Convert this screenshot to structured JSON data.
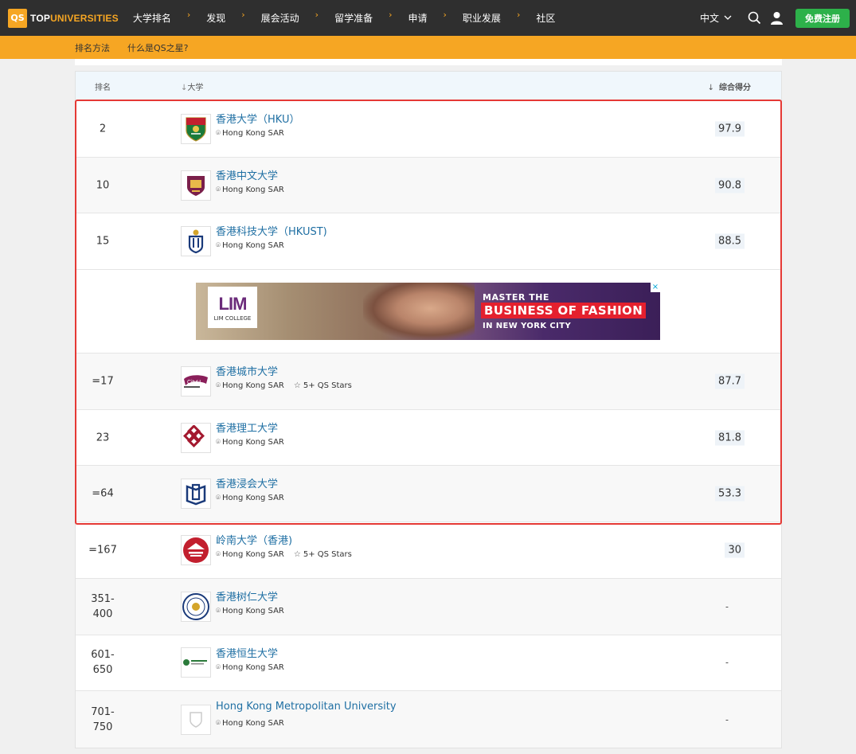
{
  "brand": {
    "logo_box": "QS",
    "logo_prefix": "TOP",
    "logo_accent": "UNIVERSITIES"
  },
  "nav": {
    "items": [
      {
        "label": "大学排名"
      },
      {
        "label": "发现"
      },
      {
        "label": "展会活动"
      },
      {
        "label": "留学准备"
      },
      {
        "label": "申请"
      },
      {
        "label": "职业发展"
      },
      {
        "label": "社区"
      }
    ],
    "language": "中文",
    "signup_label": "免费注册"
  },
  "subnav": {
    "items": [
      "排名方法",
      "什么是QS之星?"
    ]
  },
  "table": {
    "headers": {
      "rank": "排名",
      "university": "大学",
      "score": "综合得分"
    },
    "rows": [
      {
        "rank": "2",
        "name": "香港大学（HKU）",
        "location": "Hong Kong SAR",
        "stars": "",
        "score": "97.9",
        "logo": "hku-crest-icon"
      },
      {
        "rank": "10",
        "name": "香港中文大学",
        "location": "Hong Kong SAR",
        "stars": "",
        "score": "90.8",
        "logo": "cuhk-crest-icon"
      },
      {
        "rank": "15",
        "name": "香港科技大学（HKUST)",
        "location": "Hong Kong SAR",
        "stars": "",
        "score": "88.5",
        "logo": "hkust-crest-icon"
      },
      {
        "rank": "=17",
        "name": "香港城市大学",
        "location": "Hong Kong SAR",
        "stars": "5+ QS Stars",
        "score": "87.7",
        "logo": "cityu-logo-icon"
      },
      {
        "rank": "23",
        "name": "香港理工大学",
        "location": "Hong Kong SAR",
        "stars": "",
        "score": "81.8",
        "logo": "polyu-logo-icon"
      },
      {
        "rank": "=64",
        "name": "香港浸会大学",
        "location": "Hong Kong SAR",
        "stars": "",
        "score": "53.3",
        "logo": "hkbu-logo-icon"
      },
      {
        "rank": "=167",
        "name": "岭南大学（香港)",
        "location": "Hong Kong SAR",
        "stars": "5+ QS Stars",
        "score": "30",
        "logo": "lingnan-logo-icon"
      },
      {
        "rank": "351-\n400",
        "name": "香港树仁大学",
        "location": "Hong Kong SAR",
        "stars": "",
        "score": "-",
        "logo": "hksyu-seal-icon"
      },
      {
        "rank": "601-\n650",
        "name": "香港恒生大学",
        "location": "Hong Kong SAR",
        "stars": "",
        "score": "-",
        "logo": "hsuhk-logo-icon"
      },
      {
        "rank": "701-\n750",
        "name": "Hong Kong Metropolitan University",
        "location": "Hong Kong SAR",
        "stars": "",
        "score": "-",
        "logo": "placeholder-shield-icon"
      }
    ]
  },
  "ad": {
    "brand": "LIM",
    "brand_sub": "LIM COLLEGE",
    "line1": "MASTER THE",
    "line2": "BUSINESS OF FASHION",
    "line3": "IN NEW YORK CITY",
    "close": "×"
  },
  "colors": {
    "topbar": "#2f2f2f",
    "accent_orange": "#f6a623",
    "signup_green": "#2db14a",
    "link_blue": "#1f6fa3",
    "highlight_red": "#e53935"
  }
}
